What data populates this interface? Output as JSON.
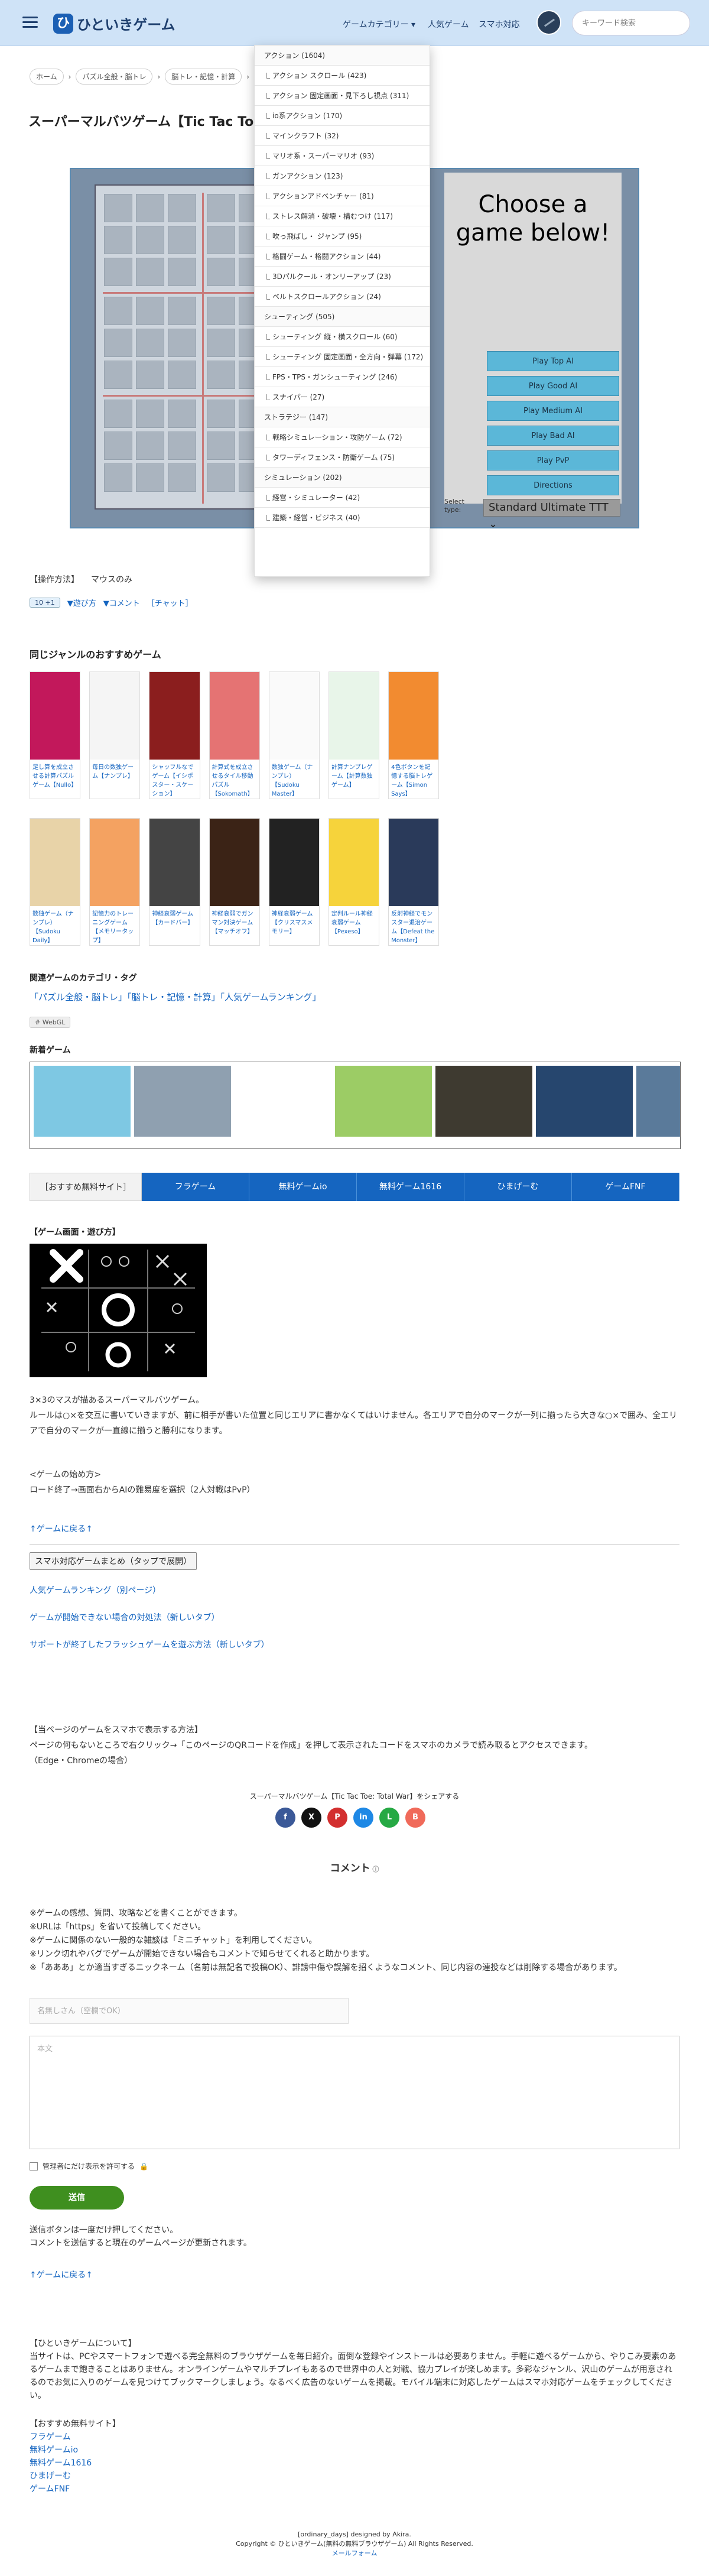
{
  "header": {
    "site_name": "ひといきゲーム",
    "logo_mark": "ひ",
    "nav": [
      "ゲームカテゴリー ▾",
      "人気ゲーム",
      "スマホ対応"
    ],
    "search_placeholder": "キーワード検索"
  },
  "breadcrumb": [
    "ホーム",
    "パズル全般・脳トレ",
    "脳トレ・記憶・計算",
    "ス"
  ],
  "page_title": "スーパーマルバツゲーム【Tic Tac Toe: Tot",
  "game": {
    "choose": "Choose a game below!",
    "options": [
      "Play Top AI",
      "Play Good AI",
      "Play Medium AI",
      "Play Bad AI",
      "Play PvP",
      "Directions"
    ],
    "select_label": "Select type:",
    "select_value": "Standard Ultimate TTT"
  },
  "dropdown": [
    {
      "head": "アクション (1604)"
    },
    {
      "item": "アクション スクロール (423)"
    },
    {
      "item": "アクション 固定画面・見下ろし視点 (311)"
    },
    {
      "item": "io系アクション (170)"
    },
    {
      "item": "マインクラフト (32)"
    },
    {
      "item": "マリオ系・スーパーマリオ (93)"
    },
    {
      "item": "ガンアクション (123)"
    },
    {
      "item": "アクションアドベンチャー (81)"
    },
    {
      "item": "ストレス解消・破壊・構むつけ (117)"
    },
    {
      "item": "吹っ飛ばし・ ジャンプ (95)"
    },
    {
      "item": "格闘ゲーム・格闘アクション (44)"
    },
    {
      "item": "3Dパルクール・オンリーアップ (23)"
    },
    {
      "item": "ベルトスクロールアクション (24)"
    },
    {
      "head": "シューティング (505)"
    },
    {
      "item": "シューティング 縦・横スクロール (60)"
    },
    {
      "item": "シューティング 固定画面・全方向・弾幕 (172)"
    },
    {
      "item": "FPS・TPS・ガンシューティング (246)"
    },
    {
      "item": "スナイパー (27)"
    },
    {
      "head": "ストラテジー (147)"
    },
    {
      "item": "戦略シミュレーション・攻防ゲーム (72)"
    },
    {
      "item": "タワーディフェンス・防衛ゲーム (75)"
    },
    {
      "head": "シミュレーション (202)"
    },
    {
      "item": "経営・シミュレーター (42)"
    },
    {
      "item": "建築・経営・ビジネス (40)"
    }
  ],
  "ops": {
    "label": "【操作方法】",
    "value": "マウスのみ"
  },
  "meta": {
    "plays": "10 +1",
    "how": "▼遊び方",
    "comment": "▼コメント",
    "chat": "［チャット］"
  },
  "related_title": "同じジャンルのおすすめゲーム",
  "related_row1": [
    "足し算を成立させる計算パズルゲーム【Nullo】",
    "毎日の数独ゲーム【ナンプレ】",
    "シャッフルなでゲーム【イシポスター・スケーション】",
    "計算式を成立させるタイル移動パズル【Sokomath】",
    "数独ゲーム（ナンプレ）【Sudoku Master】",
    "計算ナンプレゲーム【計算数独ゲーム】",
    "4色ボタンを記憶する脳トレゲーム【Simon Says】"
  ],
  "related_row2": [
    "数独ゲーム（ナンプレ）【Sudoku Daily】",
    "記憶力のトレーニングゲーム【メモリータップ】",
    "神経衰弱ゲーム【カードバー】",
    "神経衰弱でガンマン対決ゲーム【マッチオフ】",
    "神経衰弱ゲーム【クリスマスメモリー】",
    "定判ルール神経衰弱ゲーム【Pexeso】",
    "反射神経でモンスター退治ゲーム【Defeat the Monster】"
  ],
  "category_title": "関連ゲームのカテゴリ・タグ",
  "category_tags": "「パズル全般・脳トレ」「脳トレ・記憶・計算」「人気ゲームランキング」",
  "webgl": "# WebGL",
  "new_title": "新着ゲーム",
  "tabs": [
    "［おすすめ無料サイト］",
    "フラゲーム",
    "無料ゲームio",
    "無料ゲーム1616",
    "ひまげーむ",
    "ゲームFNF"
  ],
  "screen_title": "【ゲーム画面・遊び方】",
  "desc": [
    "3×3のマスが描あるスーパーマルバツゲーム。",
    "ルールは○×を交互に書いていきますが、前に相手が書いた位置と同じエリアに書かなくてはいけません。各エリアで自分のマークが一列に揃ったら大きな○×で囲み、全エリアで自分のマークが一直線に揃うと勝利になります。"
  ],
  "start": [
    "<ゲームの始め方>",
    "ロード終了→画面右からAIの難易度を選択（2人対戦はPvP）"
  ],
  "back_top": "↑ゲームに戻る↑",
  "mobile_btn": "スマホ対応ゲームまとめ（タップで展開）",
  "links": [
    "人気ゲームランキング（別ページ）",
    "ゲームが開始できない場合の対処法（新しいタブ）",
    "サポートが終了したフラッシュゲームを遊ぶ方法（新しいタブ）"
  ],
  "phone": [
    "【当ページのゲームをスマホで表示する方法】",
    "ページの何もないところで右クリック→「このページのQRコードを作成」を押して表示されたコードをスマホのカメラで読み取るとアクセスできます。",
    "（Edge・Chromeの場合）"
  ],
  "share": "スーパーマルバツゲーム【Tic Tac Toe: Total War】をシェアする",
  "share_btns": [
    "f",
    "X",
    "P",
    "in",
    "L",
    "B"
  ],
  "comment_title": "コメント",
  "rules": [
    "※ゲームの感想、質問、攻略などを書くことができます。",
    "※URLは「https」を省いて投稿してください。",
    "※ゲームに関係のない一般的な雑談は「ミニチャット」を利用してください。",
    "※リンク切れやバグでゲームが開始できない場合もコメントで知らせてくれると助かります。",
    "※「あああ」とか適当すぎるニックネーム（名前は無記名で投稿OK）、誹謗中傷や誤解を招くようなコメント、同じ内容の連投などは削除する場合があります。"
  ],
  "name_placeholder": "名無しさん（空欄でOK）",
  "body_placeholder": "本文",
  "admin_only": "管理者にだけ表示を許可する",
  "send": "送信",
  "send_notes": [
    "送信ボタンは一度だけ押してください。",
    "コメントを送信すると現在のゲームページが更新されます。"
  ],
  "about_title": "【ひといきゲームについて】",
  "about": "当サイトは、PCやスマートフォンで遊べる完全無料のブラウザゲームを毎日紹介。面倒な登録やインストールは必要ありません。手軽に遊べるゲームから、やりこみ要素のあるゲームまで飽きることはありません。オンラインゲームやマルチプレイもあるので世界中の人と対戦、協力プレイが楽しめます。多彩なジャンル、沢山のゲームが用意されるのでお気に入りのゲームを見つけてブックマークしましょう。なるべく広告のないゲームを掲載。モバイル端末に対応したゲームはスマホ対応ゲームをチェックしてください。",
  "rec_title": "【おすすめ無料サイト】",
  "rec": [
    "フラゲーム",
    "無料ゲームio",
    "無料ゲーム1616",
    "ひまげーむ",
    "ゲームFNF"
  ],
  "footer": [
    "[ordinary_days] designed by Akira.",
    "Copyright © ひといきゲーム(無料の無料ブラウザゲーム) All Rights Reserved.",
    "メールフォーム"
  ]
}
